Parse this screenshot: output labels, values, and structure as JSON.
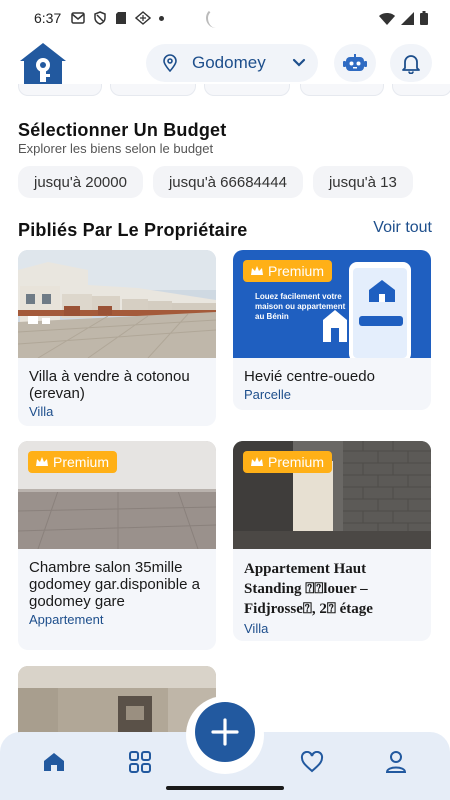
{
  "status_bar": {
    "time": "6:37"
  },
  "header": {
    "location": "Godomey",
    "icons": {
      "logo": "house-key-logo",
      "pin": "map-pin-icon",
      "chevron": "chevron-down-icon",
      "robot": "robot-icon",
      "bell": "bell-icon"
    }
  },
  "budget": {
    "title": "Sélectionner Un Budget",
    "subtitle": "Explorer les biens selon le budget",
    "chips": [
      "jusqu'à 20000",
      "jusqu'à 66684444",
      "jusqu'à 13"
    ]
  },
  "owner_listings": {
    "title": "Pibliés Par Le Propriétaire",
    "see_all": "Voir tout",
    "premium_label": "Premium",
    "cards": [
      {
        "title": "Villa à vendre à cotonou (erevan)",
        "category": "Villa",
        "premium": false
      },
      {
        "title": "Hevié centre-ouedo",
        "category": "Parcelle",
        "premium": true,
        "ad_text": "Louez facilement votre maison ou appartement au Bénin"
      },
      {
        "title": "Chambre salon 35mille godomey gar.disponible a godomey gare",
        "category": "Appartement",
        "premium": true
      },
      {
        "title": "Appartement Haut Standing ⍰⍰louer – Fidjrosse⍰, 2⍰ étage",
        "category": "Villa",
        "premium": true
      }
    ]
  },
  "bottom_nav": {
    "items": [
      "home-icon",
      "grid-icon",
      "add-icon",
      "heart-icon",
      "profile-icon"
    ]
  },
  "colors": {
    "primary": "#22599f",
    "accent": "#ffb017",
    "nav_bg": "#e6edf7",
    "chip_bg": "#f3f4f7"
  }
}
